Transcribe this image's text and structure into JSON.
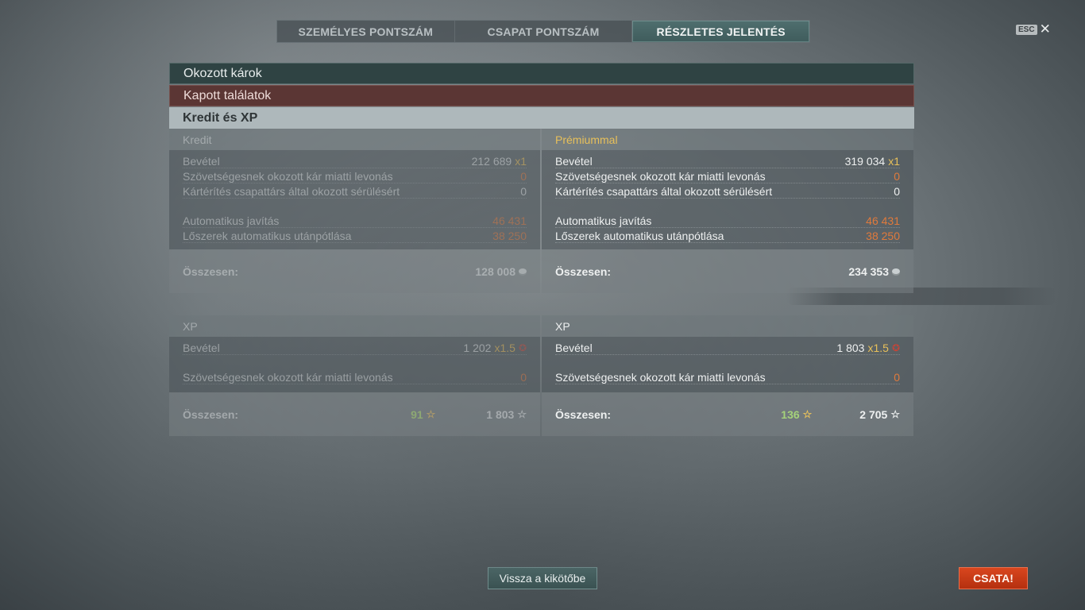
{
  "tabs": [
    {
      "label": "SZEMÉLYES PONTSZÁM",
      "active": false
    },
    {
      "label": "CSAPAT PONTSZÁM",
      "active": false
    },
    {
      "label": "RÉSZLETES JELENTÉS",
      "active": true
    }
  ],
  "esc": {
    "badge": "ESC",
    "close": "✕"
  },
  "sections": {
    "damage_caused": "Okozott károk",
    "hits_received": "Kapott találatok",
    "credit_xp": "Kredit és XP"
  },
  "credit": {
    "left": {
      "title": "Kredit",
      "income_label": "Bevétel",
      "income_value": "212 689",
      "income_mult": "x1",
      "ally_damage_label": "Szövetségesnek okozott kár miatti levonás",
      "ally_damage_value": "0",
      "compensation_label": "Kártérítés csapattárs által okozott sérülésért",
      "compensation_value": "0",
      "repair_label": "Automatikus javítás",
      "repair_value": "46 431",
      "ammo_label": "Lőszerek automatikus utánpótlása",
      "ammo_value": "38 250",
      "total_label": "Összesen:",
      "total_value": "128 008"
    },
    "right": {
      "title": "Prémiummal",
      "income_label": "Bevétel",
      "income_value": "319 034",
      "income_mult": "x1",
      "ally_damage_label": "Szövetségesnek okozott kár miatti levonás",
      "ally_damage_value": "0",
      "compensation_label": "Kártérítés csapattárs által okozott sérülésért",
      "compensation_value": "0",
      "repair_label": "Automatikus javítás",
      "repair_value": "46 431",
      "ammo_label": "Lőszerek automatikus utánpótlása",
      "ammo_value": "38 250",
      "total_label": "Összesen:",
      "total_value": "234 353"
    }
  },
  "xp": {
    "left": {
      "title": "XP",
      "income_label": "Bevétel",
      "income_value": "1 202",
      "income_mult": "x1.5",
      "ally_damage_label": "Szövetségesnek okozott kár miatti levonás",
      "ally_damage_value": "0",
      "total_label": "Összesen:",
      "total_free": "91",
      "total_value": "1 803"
    },
    "right": {
      "title": "XP",
      "income_label": "Bevétel",
      "income_value": "1 803",
      "income_mult": "x1.5",
      "ally_damage_label": "Szövetségesnek okozott kár miatti levonás",
      "ally_damage_value": "0",
      "total_label": "Összesen:",
      "total_free": "136",
      "total_value": "2 705"
    }
  },
  "buttons": {
    "back_to_port": "Vissza a kikötőbe",
    "battle": "CSATA!"
  },
  "icons": {
    "credit": "credit-coin-icon",
    "free_xp": "star-icon",
    "xp": "star-outline-icon",
    "premium_xp": "premium-star-icon"
  },
  "colors": {
    "accent_orange": "#e07a3c",
    "premium_gold": "#e8c05a",
    "free_xp_green": "#a5d27a",
    "battle_button": "#c93a15"
  }
}
